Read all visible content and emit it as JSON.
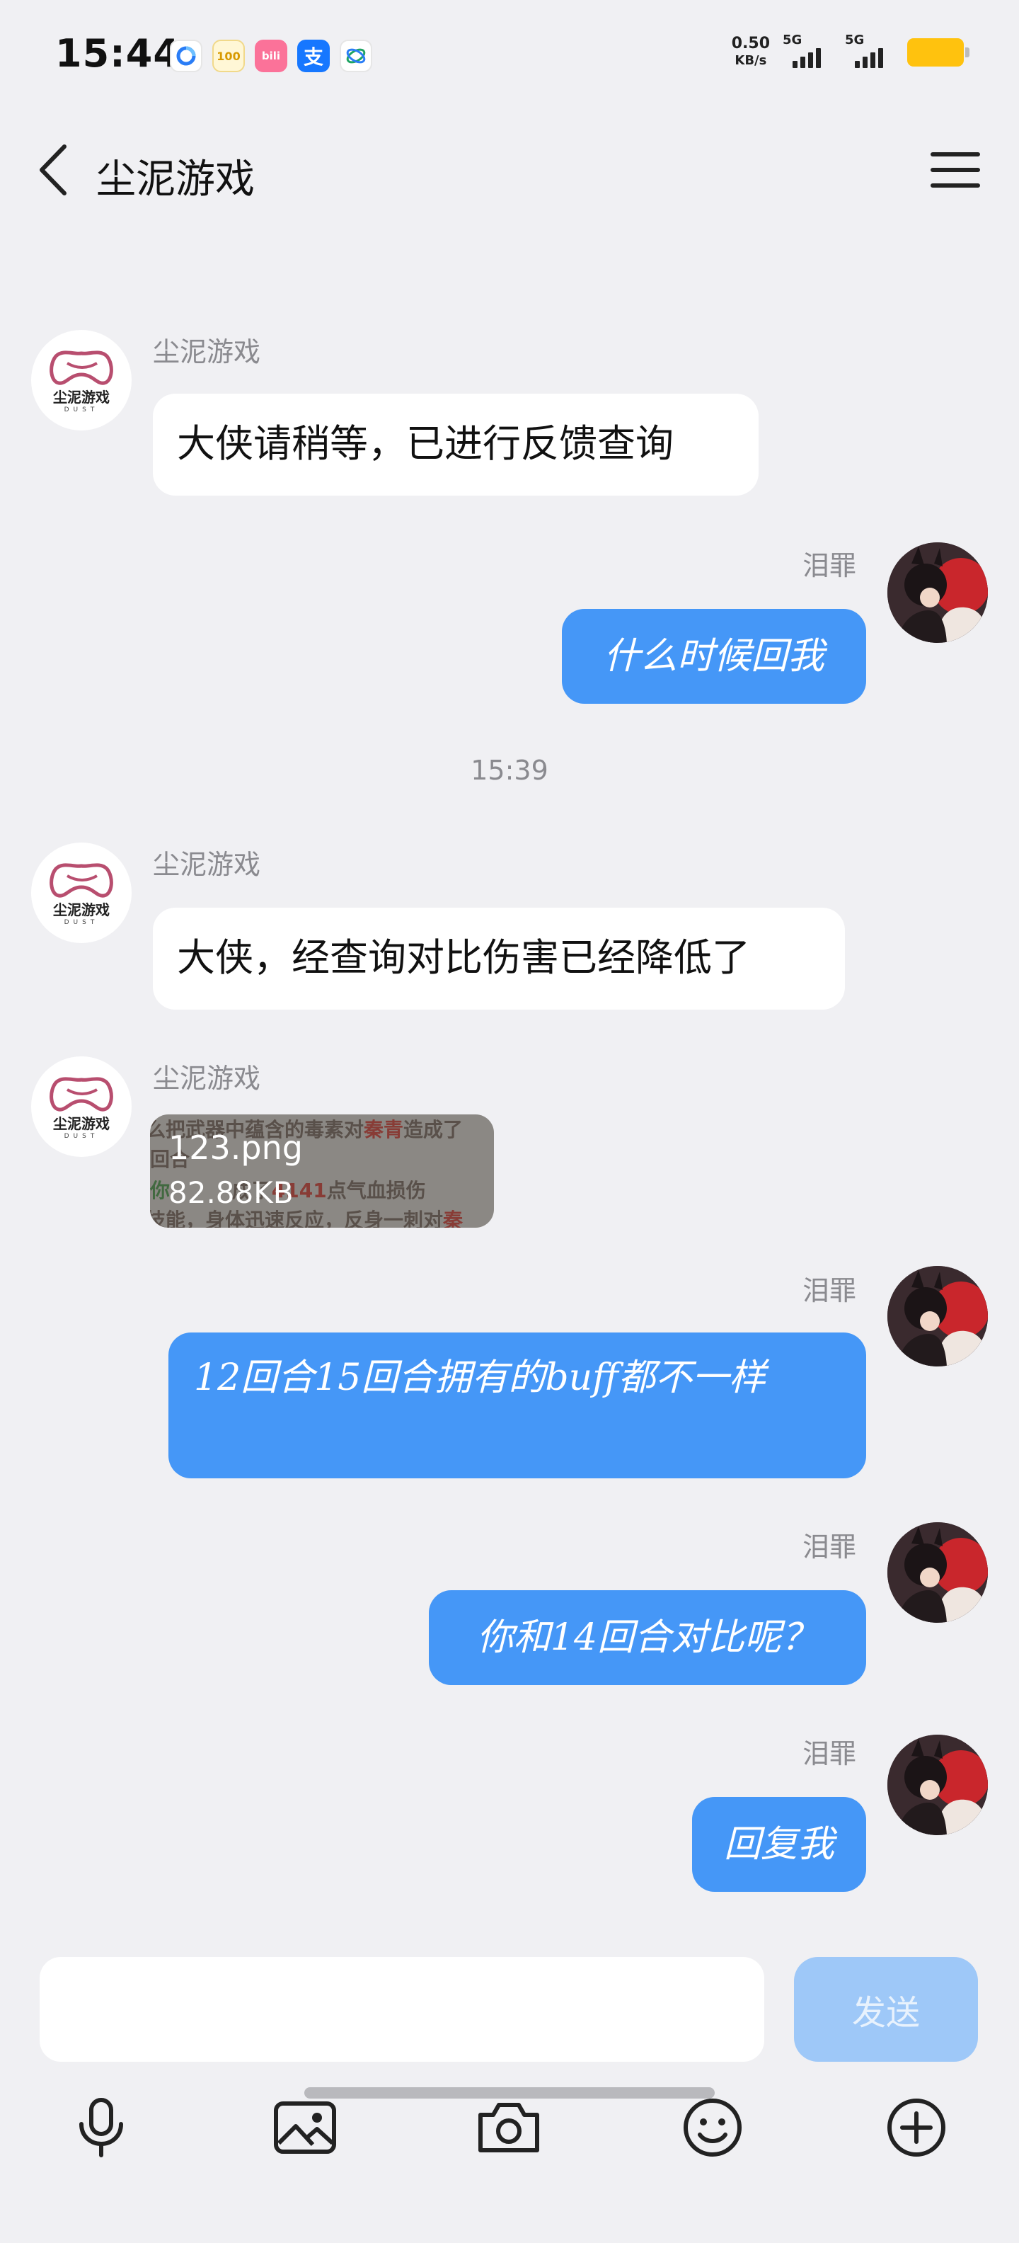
{
  "status_bar": {
    "time": "15:44",
    "net_speed_value": "0.50",
    "net_speed_unit": "KB/s",
    "sim1_label": "5G",
    "sim2_label": "5G",
    "apps": [
      {
        "icon": "browser-app-icon"
      },
      {
        "icon": "app-100-icon",
        "text": "100"
      },
      {
        "icon": "bilibili-app-icon",
        "text": "bili"
      },
      {
        "icon": "alipay-app-icon",
        "text": "支"
      },
      {
        "icon": "carrier-app-icon"
      }
    ],
    "colors": {
      "battery": "#ffc20e"
    }
  },
  "header": {
    "title": "尘泥游戏",
    "back_icon": "chevron-left-icon",
    "menu_icon": "hamburger-menu-icon"
  },
  "chat": {
    "bot_logo_text": "尘泥游戏",
    "bot_logo_sub": "DUST",
    "messages": [
      {
        "sender": "尘泥游戏",
        "text": "大侠请稍等，已进行反馈查询"
      },
      {
        "sender": "泪罪",
        "text": "什么时候回我"
      },
      {
        "timestamp": "15:39"
      },
      {
        "sender": "尘泥游戏",
        "text": "大侠，经查询对比伤害已经降低了"
      },
      {
        "sender": "尘泥游戏",
        "file_name": "123.png",
        "file_size": "82.88KB"
      },
      {
        "sender": "泪罪",
        "text": "12回合15回合拥有的buff都不一样"
      },
      {
        "sender": "泪罪",
        "text": "你和14回合对比呢？"
      },
      {
        "sender": "泪罪",
        "text": "回复我"
      }
    ],
    "image_preview_lines": {
      "line1_a": "么把武器中蕴含的毒素对",
      "line1_b": "秦青",
      "line1_c": "造成了",
      "line2": "回合",
      "line3_a": "你",
      "line3_b": "成了",
      "line3_c": "4141",
      "line3_d": "点气血损伤",
      "line4_a": "技能，身体迅速反应，反身一刺对",
      "line4_b": "秦"
    },
    "colors": {
      "outgoing_bubble": "#4597f7",
      "incoming_bubble": "#ffffff"
    }
  },
  "input_bar": {
    "placeholder": "",
    "value": "",
    "send_label": "发送",
    "tools": [
      "microphone-icon",
      "image-icon",
      "camera-icon",
      "emoji-icon",
      "plus-circle-icon"
    ],
    "colors": {
      "send_disabled": "#9ec8f8"
    }
  }
}
